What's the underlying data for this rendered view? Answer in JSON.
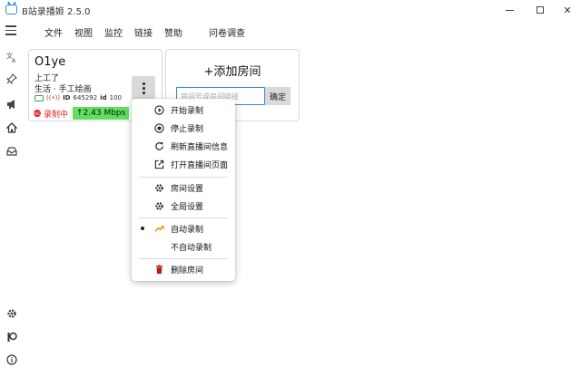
{
  "window": {
    "title": "B站录播姬 2.5.0",
    "minimize_glyph": "",
    "maximize_glyph": "",
    "close_glyph": "✕"
  },
  "menubar": {
    "items": [
      "文件",
      "视图",
      "监控",
      "链接",
      "赞助",
      "问卷调查"
    ]
  },
  "sidebar": {
    "icons": [
      "translate-icon",
      "pin-icon",
      "megaphone-icon",
      "home-icon",
      "inbox-icon",
      "gear-icon",
      "patreon-icon",
      "info-icon"
    ]
  },
  "room_card": {
    "name": "O1ye",
    "title": "上工了",
    "area": "生活 · 手工绘画",
    "id_label": "ID",
    "room_id": "645292",
    "short_id_label": "id",
    "short_id": "100",
    "rec_badge": "REC",
    "rec_status": "录制中",
    "speed": "↑2.43 Mbps"
  },
  "add_room": {
    "title": "+添加房间",
    "placeholder": "房间号或房间链接",
    "confirm_label": "确定"
  },
  "context_menu": {
    "items": [
      {
        "label": "开始录制",
        "icon": "play-circle-icon"
      },
      {
        "label": "停止录制",
        "icon": "stop-circle-icon"
      },
      {
        "label": "刷新直播间信息",
        "icon": "refresh-icon"
      },
      {
        "label": "打开直播间页面",
        "icon": "open-external-icon"
      },
      {
        "label": "房间设置",
        "icon": "gear-icon"
      },
      {
        "label": "全局设置",
        "icon": "gear-icon"
      },
      {
        "label": "自动录制",
        "icon": "auto-icon",
        "checked": true
      },
      {
        "label": "不自动录制",
        "icon": "",
        "checked": false
      },
      {
        "label": "删除房间",
        "icon": "trash-icon"
      }
    ]
  },
  "colors": {
    "accent": "#2a8fd6",
    "recording_red": "#e02020",
    "speed_green": "#5fe05a",
    "delete_red": "#b51c1c"
  }
}
